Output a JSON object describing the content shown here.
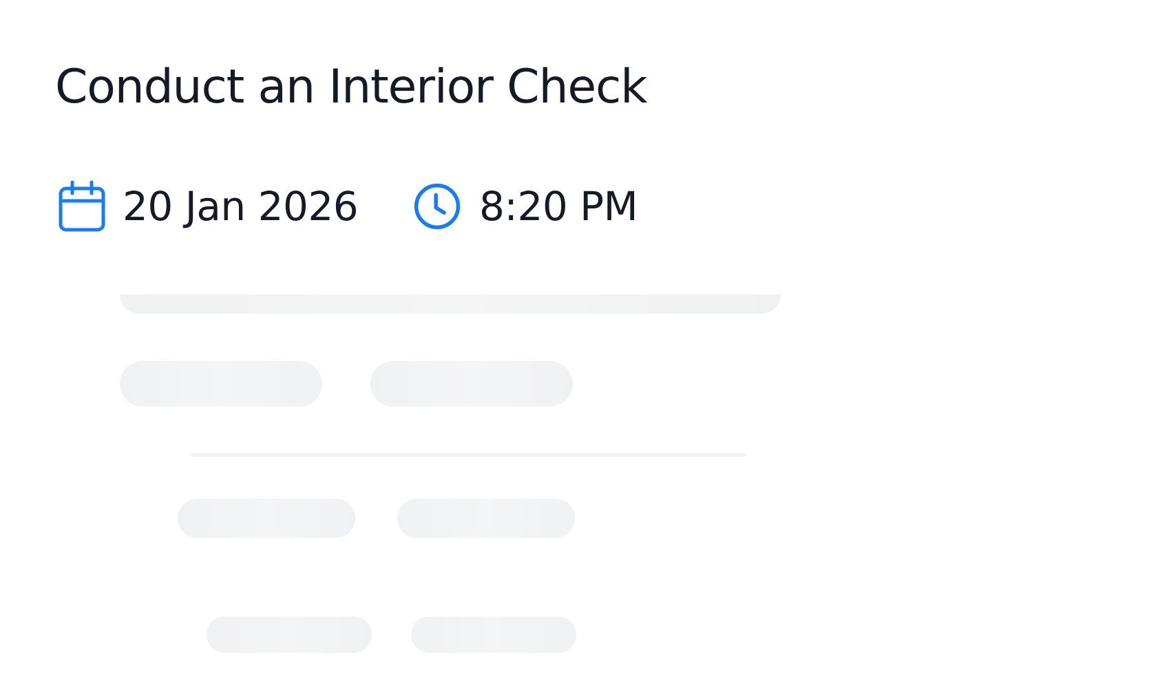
{
  "task": {
    "title": "Conduct an Interior Check",
    "date": "20 Jan 2026",
    "time": "8:20 PM"
  },
  "icons": {
    "date": "calendar-icon",
    "time": "clock-icon"
  },
  "colors": {
    "accent": "#1a7cf2",
    "text": "#141a26",
    "skeleton": "#f2f3f5"
  }
}
